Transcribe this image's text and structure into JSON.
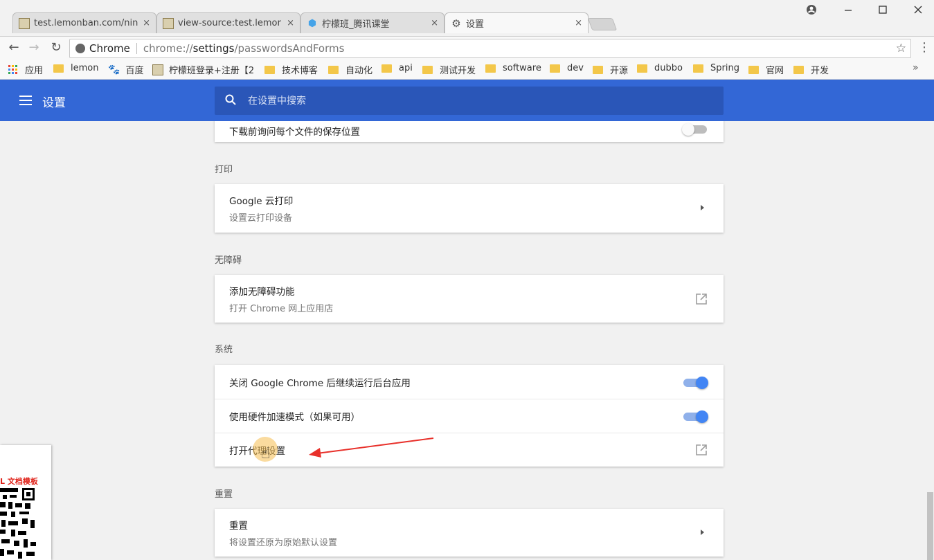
{
  "browser": {
    "tabs": [
      {
        "title": "test.lemonban.com/nin",
        "favicon": "image-icon",
        "active": false
      },
      {
        "title": "view-source:test.lemor",
        "favicon": "image-icon",
        "active": false
      },
      {
        "title": "柠檬班_腾讯课堂",
        "favicon": "shield-icon",
        "active": false
      },
      {
        "title": "设置",
        "favicon": "gear-icon",
        "active": true
      }
    ],
    "close_glyph": "×",
    "address": {
      "chip": "Chrome",
      "url_prefix": "chrome://",
      "url_host": "settings",
      "url_path": "/passwordsAndForms"
    },
    "bookmarks": {
      "apps_label": "应用",
      "items": [
        "lemon",
        "百度",
        "柠檬班登录+注册【2",
        "技术博客",
        "自动化",
        "api",
        "测试开发",
        "software",
        "dev",
        "开源",
        "dubbo",
        "Spring",
        "官网",
        "开发"
      ],
      "more": "»"
    }
  },
  "settings": {
    "title": "设置",
    "search_placeholder": "在设置中搜索",
    "downloads_row": "下载前询问每个文件的保存位置",
    "print_section": "打印",
    "cloud_print": {
      "label": "Google 云打印",
      "sub": "设置云打印设备"
    },
    "accessibility_section": "无障碍",
    "accessibility": {
      "label": "添加无障碍功能",
      "sub": "打开 Chrome 网上应用店"
    },
    "system_section": "系统",
    "system_rows": [
      {
        "label": "关闭 Google Chrome 后继续运行后台应用",
        "toggle": "on"
      },
      {
        "label": "使用硬件加速模式（如果可用）",
        "toggle": "on"
      },
      {
        "label": "打开代理设置",
        "toggle": "none"
      }
    ],
    "reset_section": "重置",
    "reset": {
      "label": "重置",
      "sub": "将设置还原为原始默认设置"
    }
  },
  "overlay": {
    "qr_caption": "L 文档模板"
  },
  "colors": {
    "header_blue": "#3367d6",
    "search_blue": "#2a56b8",
    "toggle_blue": "#4285f4",
    "annotation_red": "#e8302a"
  }
}
